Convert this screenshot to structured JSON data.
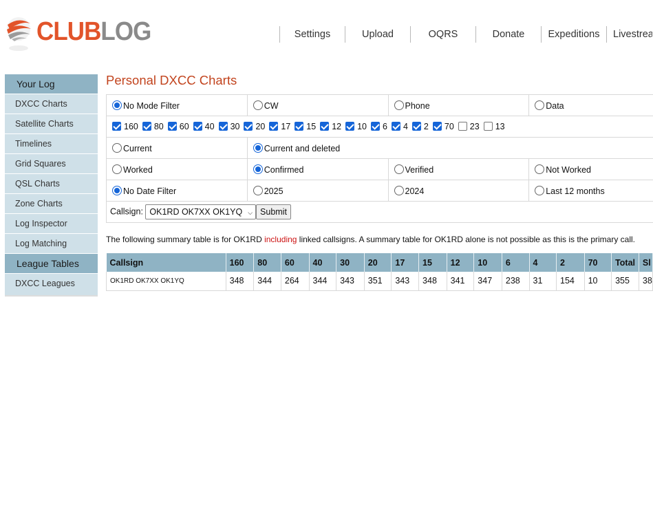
{
  "logo": {
    "club": "CLUB",
    "log": "LOG"
  },
  "nav": [
    "Settings",
    "Upload",
    "OQRS",
    "Donate",
    "Expeditions",
    "Livestream"
  ],
  "sidebar": {
    "sections": [
      {
        "title": "Your Log",
        "items": [
          "DXCC Charts",
          "Satellite Charts",
          "Timelines",
          "Grid Squares",
          "QSL Charts",
          "Zone Charts",
          "Log Inspector",
          "Log Matching"
        ]
      },
      {
        "title": "League Tables",
        "items": [
          "DXCC Leagues"
        ]
      }
    ]
  },
  "page_title": "Personal DXCC Charts",
  "filters": {
    "modes": [
      {
        "label": "No Mode Filter",
        "checked": true
      },
      {
        "label": "CW",
        "checked": false
      },
      {
        "label": "Phone",
        "checked": false
      },
      {
        "label": "Data",
        "checked": false
      }
    ],
    "bands": [
      {
        "label": "160",
        "checked": true
      },
      {
        "label": "80",
        "checked": true
      },
      {
        "label": "60",
        "checked": true
      },
      {
        "label": "40",
        "checked": true
      },
      {
        "label": "30",
        "checked": true
      },
      {
        "label": "20",
        "checked": true
      },
      {
        "label": "17",
        "checked": true
      },
      {
        "label": "15",
        "checked": true
      },
      {
        "label": "12",
        "checked": true
      },
      {
        "label": "10",
        "checked": true
      },
      {
        "label": "6",
        "checked": true
      },
      {
        "label": "4",
        "checked": true
      },
      {
        "label": "2",
        "checked": true
      },
      {
        "label": "70",
        "checked": true
      },
      {
        "label": "23",
        "checked": false
      },
      {
        "label": "13",
        "checked": false
      }
    ],
    "entities": [
      {
        "label": "Current",
        "checked": false
      },
      {
        "label": "Current and deleted",
        "checked": true
      }
    ],
    "status": [
      {
        "label": "Worked",
        "checked": false
      },
      {
        "label": "Confirmed",
        "checked": true
      },
      {
        "label": "Verified",
        "checked": false
      },
      {
        "label": "Not Worked",
        "checked": false
      }
    ],
    "dates": [
      {
        "label": "No Date Filter",
        "checked": true
      },
      {
        "label": "2025",
        "checked": false
      },
      {
        "label": "2024",
        "checked": false
      },
      {
        "label": "Last 12 months",
        "checked": false
      }
    ],
    "callsign_label": "Callsign:",
    "callsign_value": "OK1RD OK7XX OK1YQ",
    "submit_label": "Submit"
  },
  "summary": {
    "before": "The following summary table is for OK1RD ",
    "highlight": "including",
    "after": " linked callsigns. A summary table for OK1RD alone is not possible as this is the primary call."
  },
  "table": {
    "headers": [
      "Callsign",
      "160",
      "80",
      "60",
      "40",
      "30",
      "20",
      "17",
      "15",
      "12",
      "10",
      "6",
      "4",
      "2",
      "70",
      "Total",
      "Sl"
    ],
    "rows": [
      [
        "OK1RD OK7XX OK1YQ",
        "348",
        "344",
        "264",
        "344",
        "343",
        "351",
        "343",
        "348",
        "341",
        "347",
        "238",
        "31",
        "154",
        "10",
        "355",
        "38"
      ]
    ]
  },
  "colors": {
    "accent": "#c2441e",
    "sidebar_head": "#8fb3c4",
    "sidebar_item": "#cfe0e8",
    "link_red": "#cc1111"
  }
}
